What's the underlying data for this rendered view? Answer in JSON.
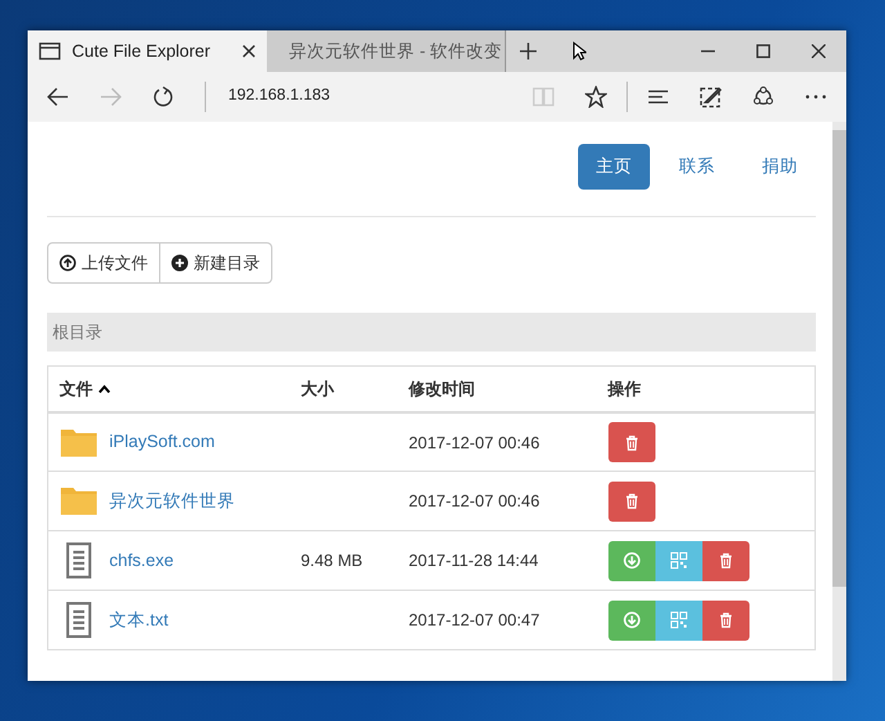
{
  "browser": {
    "tabs": [
      {
        "title": "Cute File Explorer",
        "selected": true,
        "kind": "page"
      },
      {
        "title": "异次元软件世界 - 软件改变",
        "selected": false,
        "kind": "site"
      }
    ],
    "can_go_forward": false,
    "reading_view_available": false,
    "address": "192.168.1.183"
  },
  "nav": [
    {
      "label": "主页",
      "selected": true
    },
    {
      "label": "联系",
      "selected": false
    },
    {
      "label": "捐助",
      "selected": false
    }
  ],
  "toolbar_buttons": [
    {
      "label": "上传文件",
      "kind": "upload"
    },
    {
      "label": "新建目录",
      "kind": "new-folder"
    }
  ],
  "breadcrumb": "根目录",
  "table": {
    "columns": [
      {
        "label": "文件",
        "sorted": true
      },
      {
        "label": "大小",
        "sorted": false
      },
      {
        "label": "修改时间",
        "sorted": false
      },
      {
        "label": "操作",
        "sorted": false
      }
    ],
    "rows": [
      {
        "kind": "folder",
        "name": "iPlaySoft.com",
        "modified": "2017-12-07 00:46",
        "actions": [
          {
            "kind": "delete"
          }
        ]
      },
      {
        "kind": "folder",
        "name": "异次元软件世界",
        "modified": "2017-12-07 00:46",
        "actions": [
          {
            "kind": "delete"
          }
        ]
      },
      {
        "kind": "file",
        "name": "chfs.exe",
        "size": "9.48 MB",
        "modified": "2017-11-28 14:44",
        "actions": [
          {
            "kind": "download"
          },
          {
            "kind": "qr"
          },
          {
            "kind": "delete"
          }
        ]
      },
      {
        "kind": "file",
        "name": "文本.txt",
        "modified": "2017-12-07 00:47",
        "actions": [
          {
            "kind": "download"
          },
          {
            "kind": "qr"
          },
          {
            "kind": "delete"
          }
        ]
      }
    ]
  }
}
